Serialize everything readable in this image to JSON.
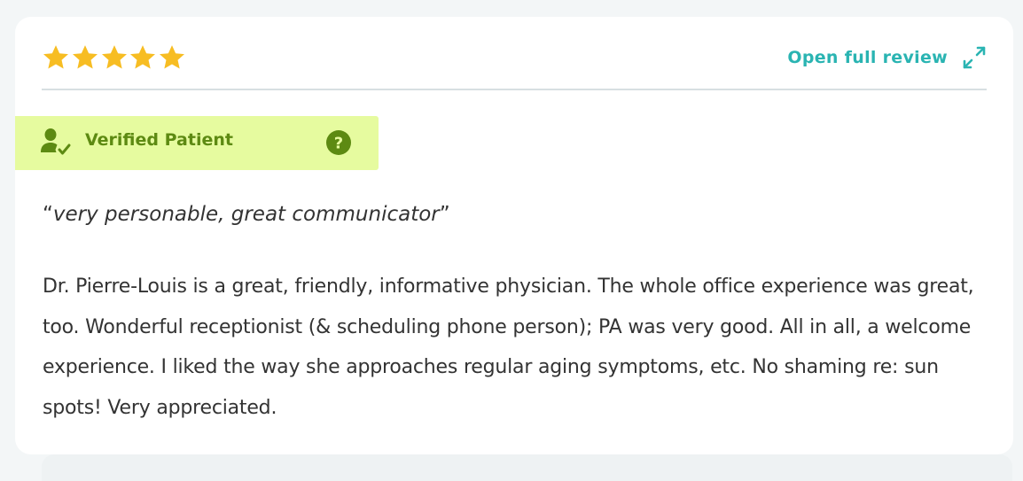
{
  "review": {
    "rating": 5,
    "rating_max": 5,
    "open_full_review_label": "Open full review",
    "verified_label": "Verified Patient",
    "quote_open": "“",
    "title": "very personable, great communicator",
    "quote_close": "”",
    "body": "Dr. Pierre-Louis is a great, friendly, informative physician. The whole office experience was great, too. Wonderful receptionist (& scheduling phone person); PA was very good. All in all, a welcome experience. I liked the way she approaches regular aging symptoms, etc. No shaming re: sun spots! Very appreciated."
  },
  "icons": {
    "star": "star-icon",
    "expand": "expand-icon",
    "verified": "verified-patient-icon",
    "help": "question-mark-icon"
  },
  "colors": {
    "star": "#f7bd23",
    "accent": "#2ab4b2",
    "verified_bg": "#e6fb9f",
    "verified_text": "#5d8a12",
    "body_text": "#333333",
    "page_bg": "#f3f6f7",
    "card_bg": "#ffffff"
  }
}
